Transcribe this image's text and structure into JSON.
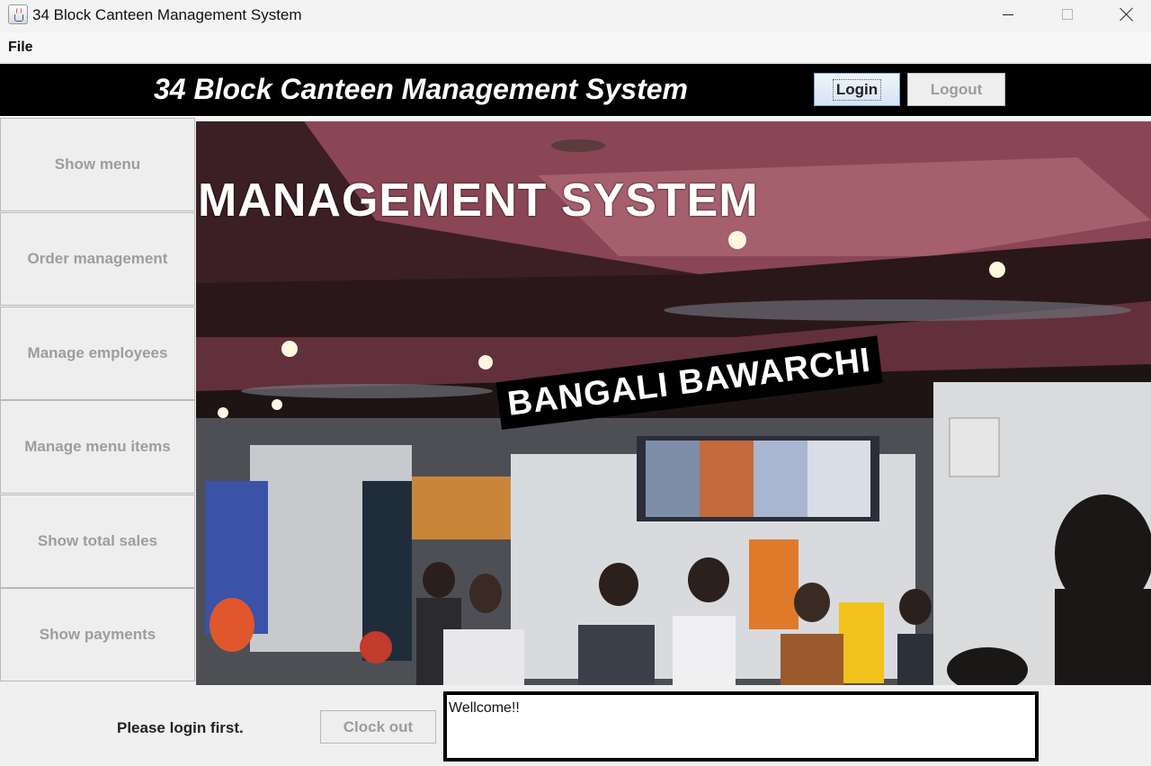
{
  "window": {
    "title": "34 Block Canteen Management System"
  },
  "menubar": {
    "file": "File"
  },
  "header": {
    "title": "34 Block Canteen Management System",
    "login_label": "Login",
    "logout_label": "Logout"
  },
  "sidebar": {
    "items": [
      {
        "label": "Show menu"
      },
      {
        "label": "Order management"
      },
      {
        "label": "Manage employees"
      },
      {
        "label": "Manage menu items"
      },
      {
        "label": "Show total sales"
      },
      {
        "label": "Show payments"
      }
    ]
  },
  "hero": {
    "heading": "MANAGEMENT SYSTEM",
    "banner": "BANGALI BAWARCHI"
  },
  "status": {
    "text": "Please login first.",
    "clock_out_label": "Clock out"
  },
  "message": {
    "text": "Wellcome!!"
  },
  "colors": {
    "header_bg": "#000000",
    "login_accent": "#7aa2d4",
    "disabled_text": "#9c9c9c"
  }
}
